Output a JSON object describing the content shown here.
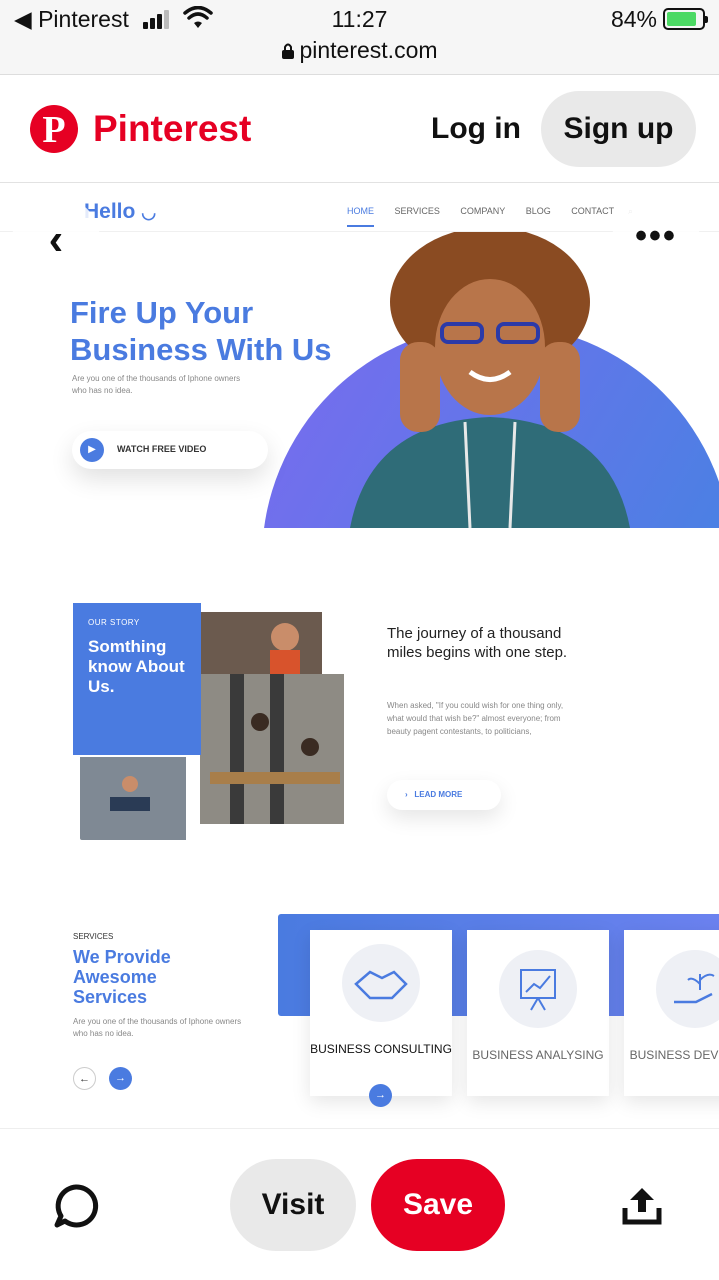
{
  "status_bar": {
    "back_app": "◀ Pinterest",
    "time": "11:27",
    "url": "pinterest.com",
    "battery": "84%"
  },
  "header": {
    "brand": "Pinterest",
    "login": "Log in",
    "signup": "Sign up"
  },
  "pin": {
    "site_logo": "Hello",
    "site_logo_smile": "◡",
    "nav": [
      "HOME",
      "SERVICES",
      "COMPANY",
      "BLOG",
      "CONTACT"
    ],
    "hero_title": "Fire Up Your Business With Us",
    "hero_sub": "Are you one of the thousands of Iphone owners who has no idea.",
    "watch_video": "WATCH FREE VIDEO",
    "story_label": "OUR STORY",
    "story_title": "Somthing know About Us.",
    "journey": "The journey of a thousand miles begins with one step.",
    "journey_text": "When asked, \"If you could wish for one thing only, what would that wish be?\" almost everyone; from beauty pagent contestants, to politicians,",
    "lead_more": "LEAD MORE",
    "services_label": "SERVICES",
    "services_title": "We Provide Awesome Services",
    "services_sub": "Are you one of the thousands of Iphone owners who has no idea.",
    "cards": [
      {
        "name": "BUSINESS CONSULTING",
        "icon": "handshake-icon"
      },
      {
        "name": "BUSINESS ANALYSING",
        "icon": "presentation-chart-icon"
      },
      {
        "name": "BUSINESS DEVELOPM",
        "icon": "hand-plant-icon"
      }
    ]
  },
  "actions": {
    "visit": "Visit",
    "save": "Save"
  },
  "colors": {
    "pinterest_red": "#e60023",
    "site_blue": "#4a7be0"
  }
}
